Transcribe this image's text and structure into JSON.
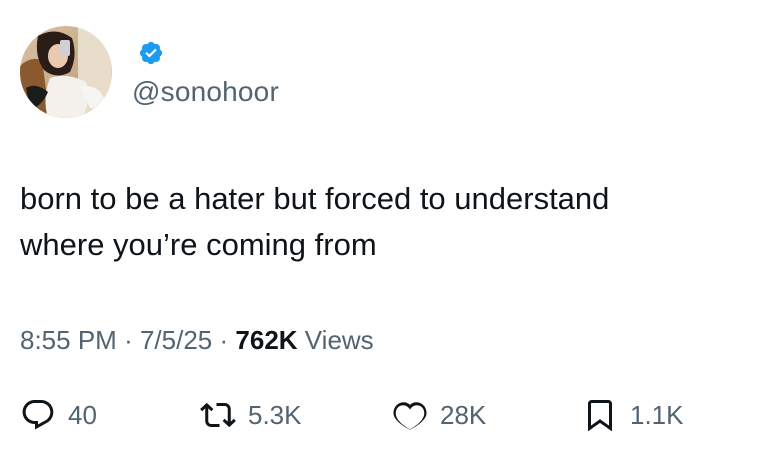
{
  "user": {
    "handle": "@sonohoor",
    "verified": true,
    "badge_color": "#1d9bf0"
  },
  "tweet": {
    "text_lines": [
      "born to be a hater but forced to understand",
      "where you’re coming from"
    ]
  },
  "meta": {
    "time": "8:55 PM",
    "separator": "·",
    "date": "7/5/25",
    "views_count": "762K",
    "views_label": "Views"
  },
  "actions": {
    "replies": "40",
    "reposts": "5.3K",
    "likes": "28K",
    "bookmarks": "1.1K"
  },
  "icons": {
    "reply": "speech-bubble-icon",
    "repost": "repost-arrows-icon",
    "like": "heart-icon",
    "bookmark": "bookmark-icon",
    "verified": "verified-checkmark-icon"
  },
  "colors": {
    "text_primary": "#0f1419",
    "text_secondary": "#536471",
    "verified_blue": "#1d9bf0"
  }
}
